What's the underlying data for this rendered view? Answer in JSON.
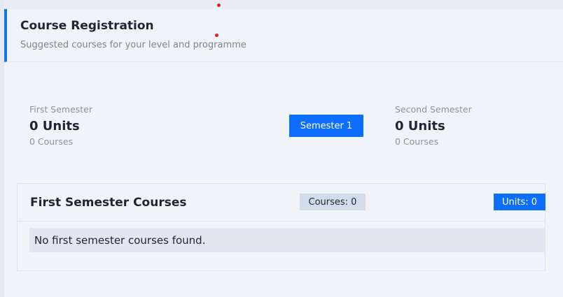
{
  "header": {
    "title": "Course Registration",
    "subtitle": "Suggested courses for your level and programme"
  },
  "summary": {
    "first": {
      "label": "First Semester",
      "units": "0 Units",
      "courses": "0 Courses"
    },
    "second": {
      "label": "Second Semester",
      "units": "0 Units",
      "courses": "0 Courses"
    },
    "toggle_label": "Semester 1"
  },
  "first_semester_courses": {
    "title": "First Semester Courses",
    "courses_badge": "Courses: 0",
    "units_badge": "Units: 0",
    "empty_message": "No first semester courses found."
  },
  "colors": {
    "accent": "#0d6efd",
    "indicator_dot": "#e02424"
  }
}
